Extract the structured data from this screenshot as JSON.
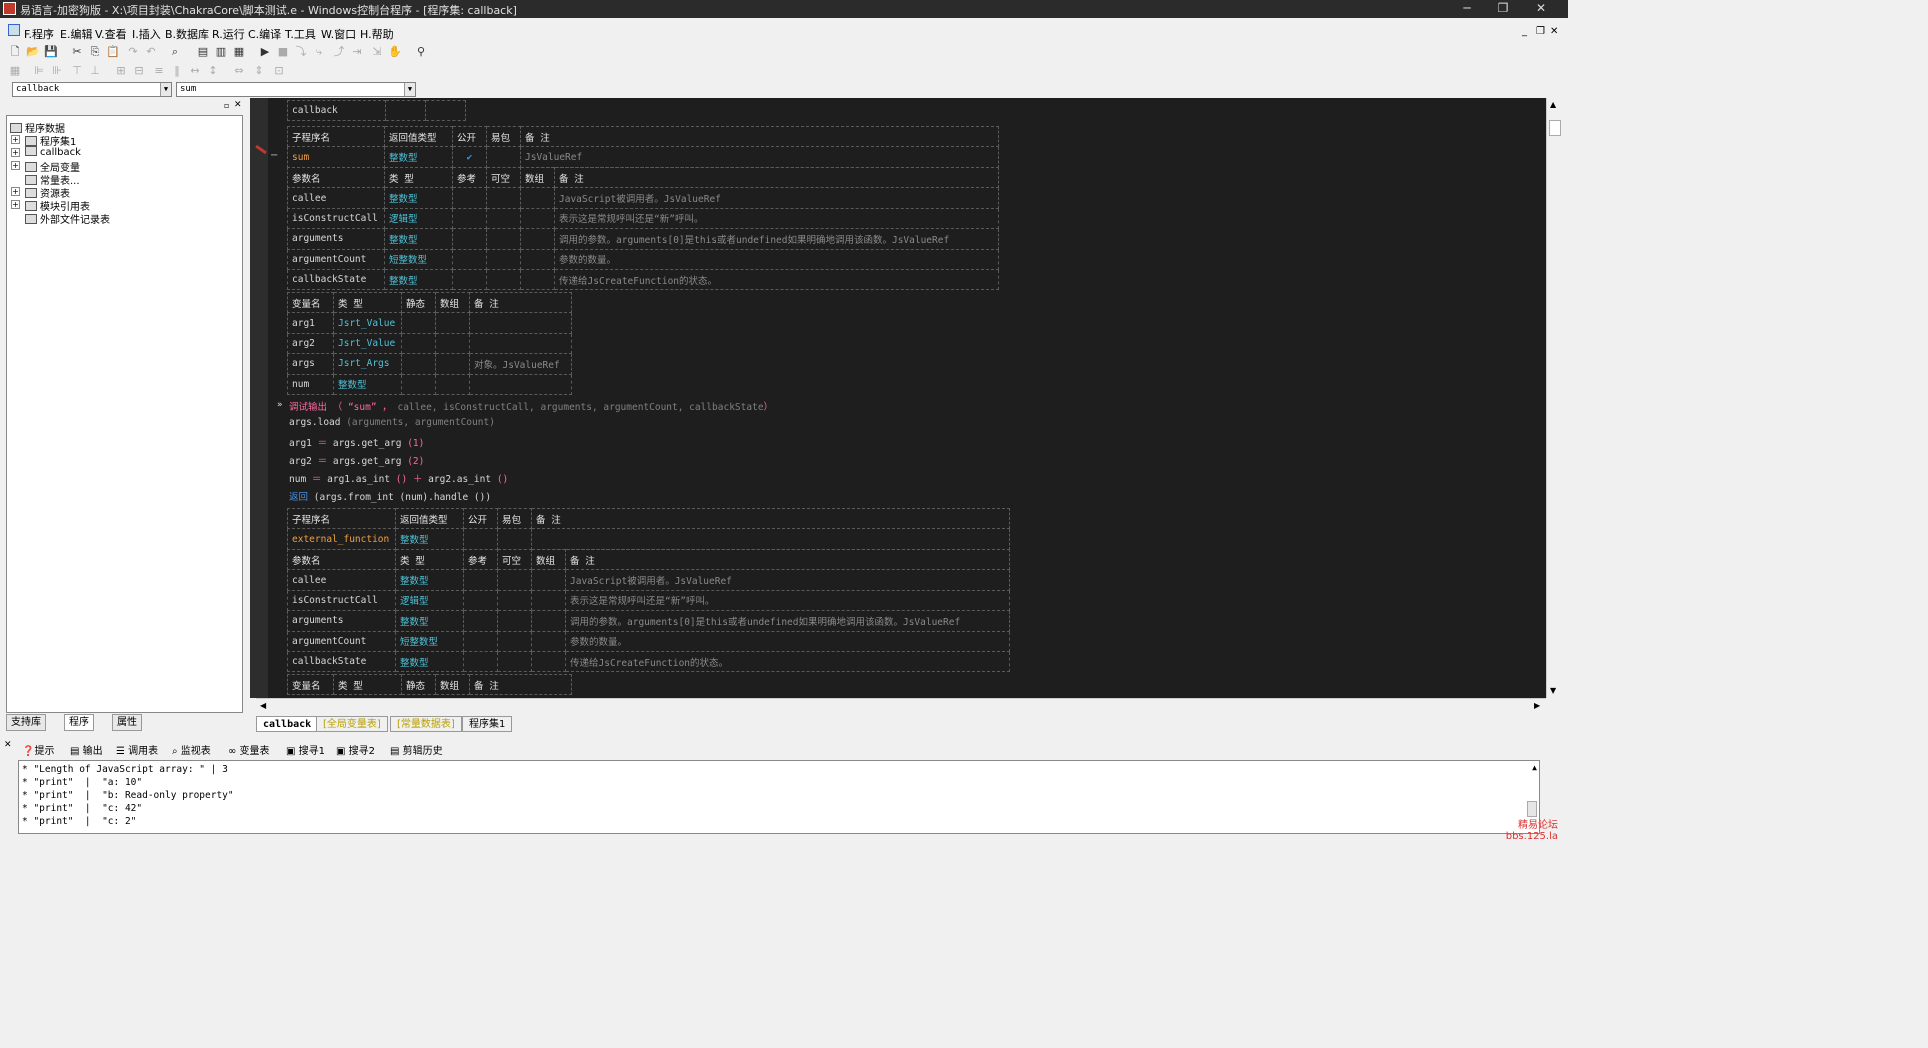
{
  "window": {
    "title": "易语言-加密狗版 - X:\\项目封装\\ChakraCore\\脚本测试.e - Windows控制台程序 - [程序集: callback]",
    "controls": [
      "─",
      "❐",
      "✕"
    ]
  },
  "menu": [
    "F.程序",
    "E.编辑",
    "V.查看",
    "I.插入",
    "B.数据库",
    "R.运行",
    "C.编译",
    "T.工具",
    "W.窗口",
    "H.帮助"
  ],
  "combos": {
    "left": "callback",
    "right": "sum"
  },
  "tree": {
    "root": "程序数据",
    "items": [
      "程序集1",
      "callback",
      "全局变量",
      "常量表...",
      "资源表",
      "模块引用表",
      "外部文件记录表"
    ]
  },
  "left_tabs": [
    "支持库",
    "程序",
    "属性"
  ],
  "code": {
    "assembly_name": "callback",
    "sub_header": [
      "子程序名",
      "返回值类型",
      "公开",
      "易包",
      "备 注"
    ],
    "param_header": [
      "参数名",
      "类 型",
      "参考",
      "可空",
      "数组",
      "备 注"
    ],
    "var_header": [
      "变量名",
      "类 型",
      "静态",
      "数组",
      "备 注"
    ],
    "sub1": {
      "name": "sum",
      "ret": "整数型",
      "public": "✔",
      "remark": "JsValueRef",
      "params": [
        {
          "name": "callee",
          "type": "整数型",
          "remark": "JavaScript被调用者。JsValueRef"
        },
        {
          "name": "isConstructCall",
          "type": "逻辑型",
          "remark": "表示这是常规呼叫还是“新”呼叫。"
        },
        {
          "name": "arguments",
          "type": "整数型",
          "remark": "调用的参数。arguments[0]是this或者undefined如果明确地调用该函数。JsValueRef"
        },
        {
          "name": "argumentCount",
          "type": "短整数型",
          "remark": "参数的数量。"
        },
        {
          "name": "callbackState",
          "type": "整数型",
          "remark": "传递给JsCreateFunction的状态。"
        }
      ],
      "vars": [
        {
          "name": "arg1",
          "type": "Jsrt_Value",
          "remark": ""
        },
        {
          "name": "arg2",
          "type": "Jsrt_Value",
          "remark": ""
        },
        {
          "name": "args",
          "type": "Jsrt_Args",
          "remark": "对象。JsValueRef"
        },
        {
          "name": "num",
          "type": "整数型",
          "remark": ""
        }
      ],
      "lines": {
        "l1_a": "调试输出 （ “sum” ，",
        "l1_b": " callee, isConstructCall, arguments, argumentCount, callbackState",
        "l1_c": "）",
        "l2_a": "args.load ",
        "l2_b": "(arguments, argumentCount)",
        "l3_a": "arg1 ",
        "l3_eq": "＝",
        "l3_b": " args.get_arg ",
        "l3_c": "(1)",
        "l4_a": "arg2 ",
        "l4_eq": "＝",
        "l4_b": " args.get_arg ",
        "l4_c": "(2)",
        "l5_a": "num ",
        "l5_eq": "＝",
        "l5_b": " arg1.as_int ",
        "l5_c": "()",
        "l5_plus": " ＋ ",
        "l5_d": "arg2.as_int ",
        "l5_e": "()",
        "l6_kw": "返回 ",
        "l6_b": "(args.from_int (num).handle ())"
      }
    },
    "sub2": {
      "name": "external_function",
      "ret": "整数型",
      "params": [
        {
          "name": "callee",
          "type": "整数型",
          "remark": "JavaScript被调用者。JsValueRef"
        },
        {
          "name": "isConstructCall",
          "type": "逻辑型",
          "remark": "表示这是常规呼叫还是“新”呼叫。"
        },
        {
          "name": "arguments",
          "type": "整数型",
          "remark": "调用的参数。arguments[0]是this或者undefined如果明确地调用该函数。JsValueRef"
        },
        {
          "name": "argumentCount",
          "type": "短整数型",
          "remark": "参数的数量。"
        },
        {
          "name": "callbackState",
          "type": "整数型",
          "remark": "传递给JsCreateFunction的状态。"
        }
      ]
    }
  },
  "doc_tabs": [
    "callback",
    "[全局变量表]",
    "[常量数据表]",
    "程序集1"
  ],
  "bottom_tabs": [
    "提示",
    "输出",
    "调用表",
    "监视表",
    "变量表",
    "搜寻1",
    "搜寻2",
    "剪辑历史"
  ],
  "output_lines": [
    "* \"Length of JavaScript array: \" | 3",
    "* \"print\"  |  \"a: 10\"",
    "* \"print\"  |  \"b: Read-only property\"",
    "* \"print\"  |  \"c: 42\"",
    "* \"print\"  |  \"c: 2\""
  ],
  "watermark": [
    "精易论坛",
    "bbs.125.la"
  ],
  "colors": {
    "editor_bg": "#1e1e1e",
    "keyword": "#ff6aa0",
    "name": "#f0a040",
    "type": "#4ec3d8"
  }
}
